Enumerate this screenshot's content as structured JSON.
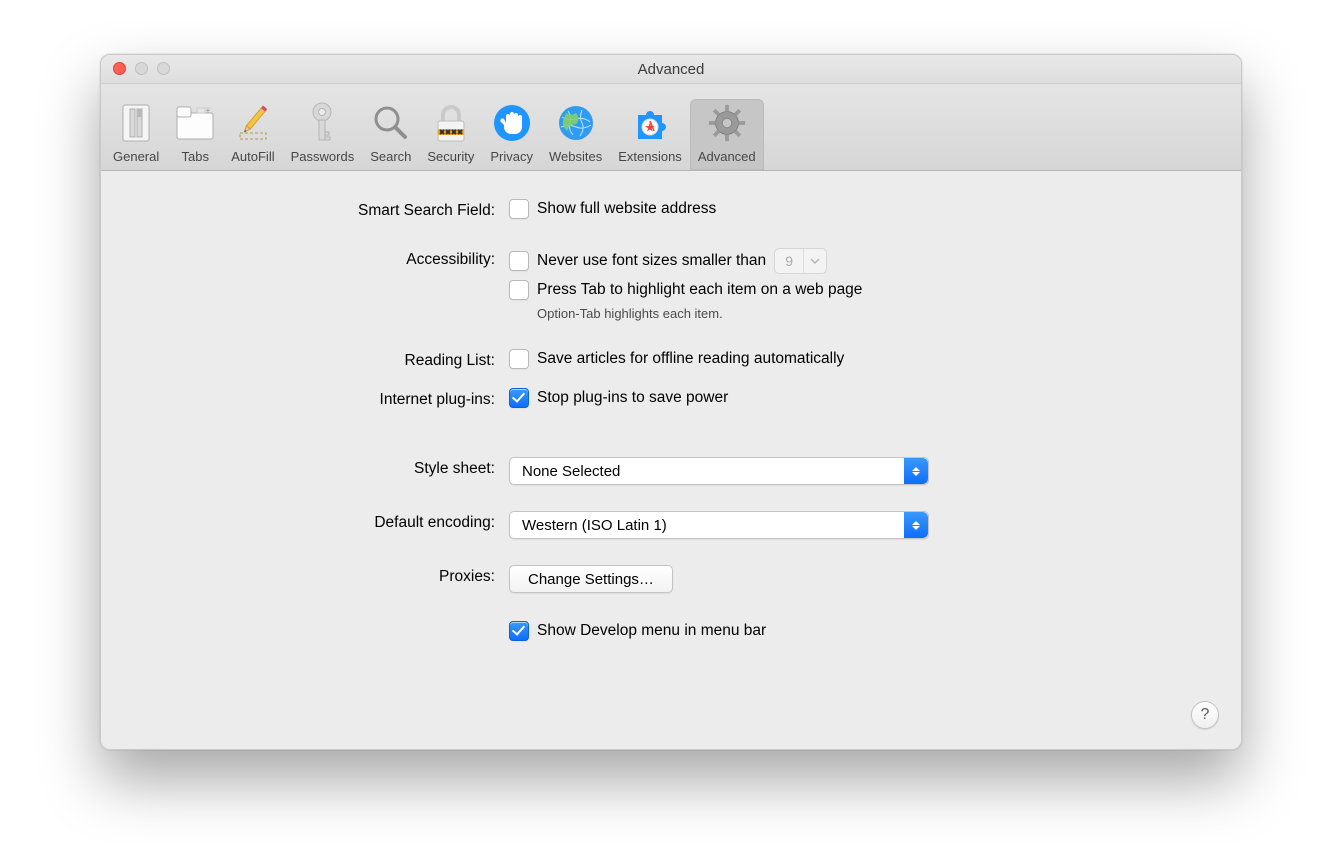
{
  "window": {
    "title": "Advanced"
  },
  "toolbar": {
    "tabs": [
      {
        "label": "General"
      },
      {
        "label": "Tabs"
      },
      {
        "label": "AutoFill"
      },
      {
        "label": "Passwords"
      },
      {
        "label": "Search"
      },
      {
        "label": "Security"
      },
      {
        "label": "Privacy"
      },
      {
        "label": "Websites"
      },
      {
        "label": "Extensions"
      },
      {
        "label": "Advanced",
        "selected": true
      }
    ]
  },
  "sections": {
    "smart_search": {
      "label": "Smart Search Field:",
      "show_full_address": {
        "text": "Show full website address",
        "checked": false
      }
    },
    "accessibility": {
      "label": "Accessibility:",
      "min_font": {
        "text": "Never use font sizes smaller than",
        "checked": false,
        "value": "9"
      },
      "press_tab": {
        "text": "Press Tab to highlight each item on a web page",
        "checked": false
      },
      "note": "Option-Tab highlights each item."
    },
    "reading_list": {
      "label": "Reading List:",
      "save_offline": {
        "text": "Save articles for offline reading automatically",
        "checked": false
      }
    },
    "internet_plugins": {
      "label": "Internet plug-ins:",
      "stop_plugins": {
        "text": "Stop plug-ins to save power",
        "checked": true
      }
    },
    "style_sheet": {
      "label": "Style sheet:",
      "value": "None Selected"
    },
    "default_encoding": {
      "label": "Default encoding:",
      "value": "Western (ISO Latin 1)"
    },
    "proxies": {
      "label": "Proxies:",
      "button": "Change Settings…"
    },
    "develop_menu": {
      "text": "Show Develop menu in menu bar",
      "checked": true
    }
  },
  "help": "?"
}
